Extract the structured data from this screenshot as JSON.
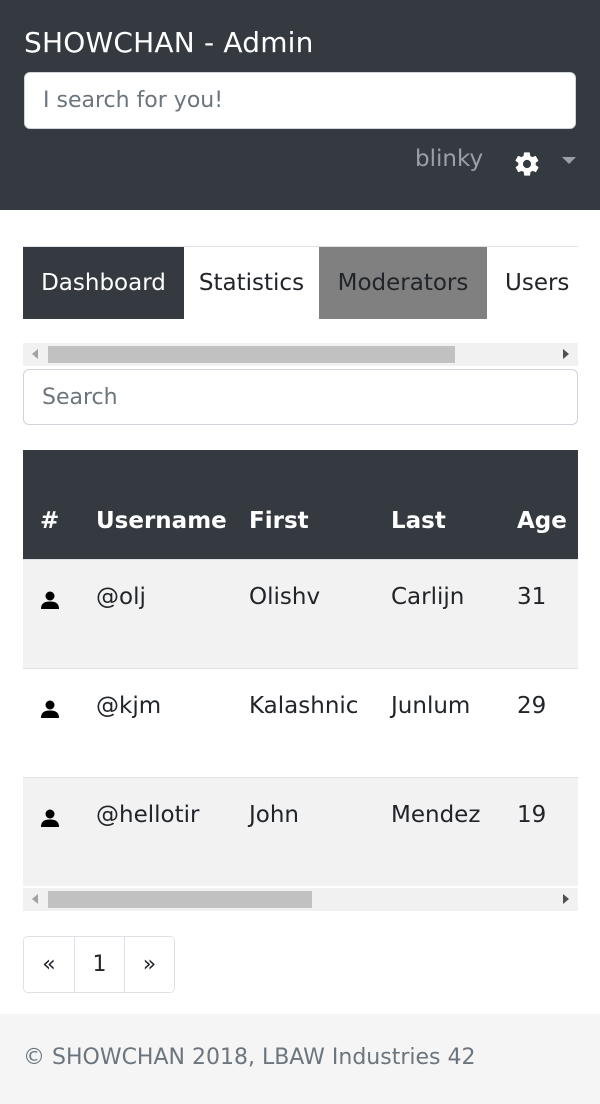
{
  "app": {
    "title": "SHOWCHAN - Admin",
    "search_placeholder": "I search for you!",
    "user": "blinky"
  },
  "tabs": [
    {
      "label": "Dashboard",
      "active": true
    },
    {
      "label": "Statistics",
      "active": false
    },
    {
      "label": "Moderators",
      "active": false
    },
    {
      "label": "Users",
      "active": false
    }
  ],
  "table": {
    "search_placeholder": "Search",
    "headers": [
      "#",
      "Username",
      "First",
      "Last",
      "Age"
    ],
    "rows": [
      {
        "icon": "user-icon",
        "username": "@olj",
        "first": "Olishv",
        "last": "Carlijn",
        "age": "31"
      },
      {
        "icon": "user-icon",
        "username": "@kjm",
        "first": "Kalashnic",
        "last": "Junlum",
        "age": "29"
      },
      {
        "icon": "user-icon",
        "username": "@hellotir",
        "first": "John",
        "last": "Mendez",
        "age": "19"
      }
    ]
  },
  "pagination": {
    "prev": "«",
    "pages": [
      "1"
    ],
    "next": "»"
  },
  "footer": {
    "text": "© SHOWCHAN 2018, LBAW Industries 42"
  },
  "colors": {
    "header_bg": "#343a40",
    "active_tab_bg": "#343a40",
    "highlight_tab_bg": "#808080",
    "footer_bg": "#f5f5f5"
  }
}
